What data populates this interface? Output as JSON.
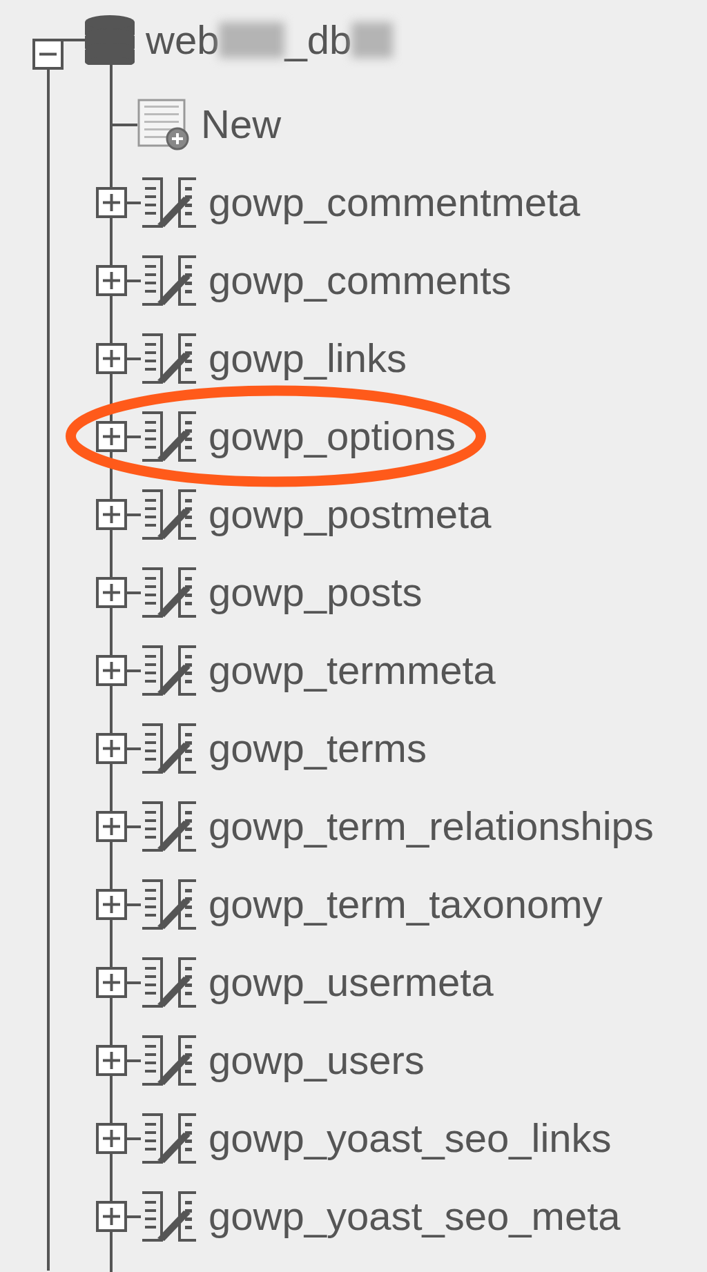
{
  "tree": {
    "database": {
      "name_parts": [
        "web",
        "_db"
      ],
      "expanded": true,
      "children": [
        {
          "kind": "new",
          "label": "New"
        },
        {
          "kind": "table",
          "label": "gowp_commentmeta",
          "expanded": false,
          "highlighted": false
        },
        {
          "kind": "table",
          "label": "gowp_comments",
          "expanded": false,
          "highlighted": false
        },
        {
          "kind": "table",
          "label": "gowp_links",
          "expanded": false,
          "highlighted": false
        },
        {
          "kind": "table",
          "label": "gowp_options",
          "expanded": false,
          "highlighted": true
        },
        {
          "kind": "table",
          "label": "gowp_postmeta",
          "expanded": false,
          "highlighted": false
        },
        {
          "kind": "table",
          "label": "gowp_posts",
          "expanded": false,
          "highlighted": false
        },
        {
          "kind": "table",
          "label": "gowp_termmeta",
          "expanded": false,
          "highlighted": false
        },
        {
          "kind": "table",
          "label": "gowp_terms",
          "expanded": false,
          "highlighted": false
        },
        {
          "kind": "table",
          "label": "gowp_term_relationships",
          "expanded": false,
          "highlighted": false
        },
        {
          "kind": "table",
          "label": "gowp_term_taxonomy",
          "expanded": false,
          "highlighted": false
        },
        {
          "kind": "table",
          "label": "gowp_usermeta",
          "expanded": false,
          "highlighted": false
        },
        {
          "kind": "table",
          "label": "gowp_users",
          "expanded": false,
          "highlighted": false
        },
        {
          "kind": "table",
          "label": "gowp_yoast_seo_links",
          "expanded": false,
          "highlighted": false
        },
        {
          "kind": "table",
          "label": "gowp_yoast_seo_meta",
          "expanded": false,
          "highlighted": false
        }
      ]
    }
  }
}
